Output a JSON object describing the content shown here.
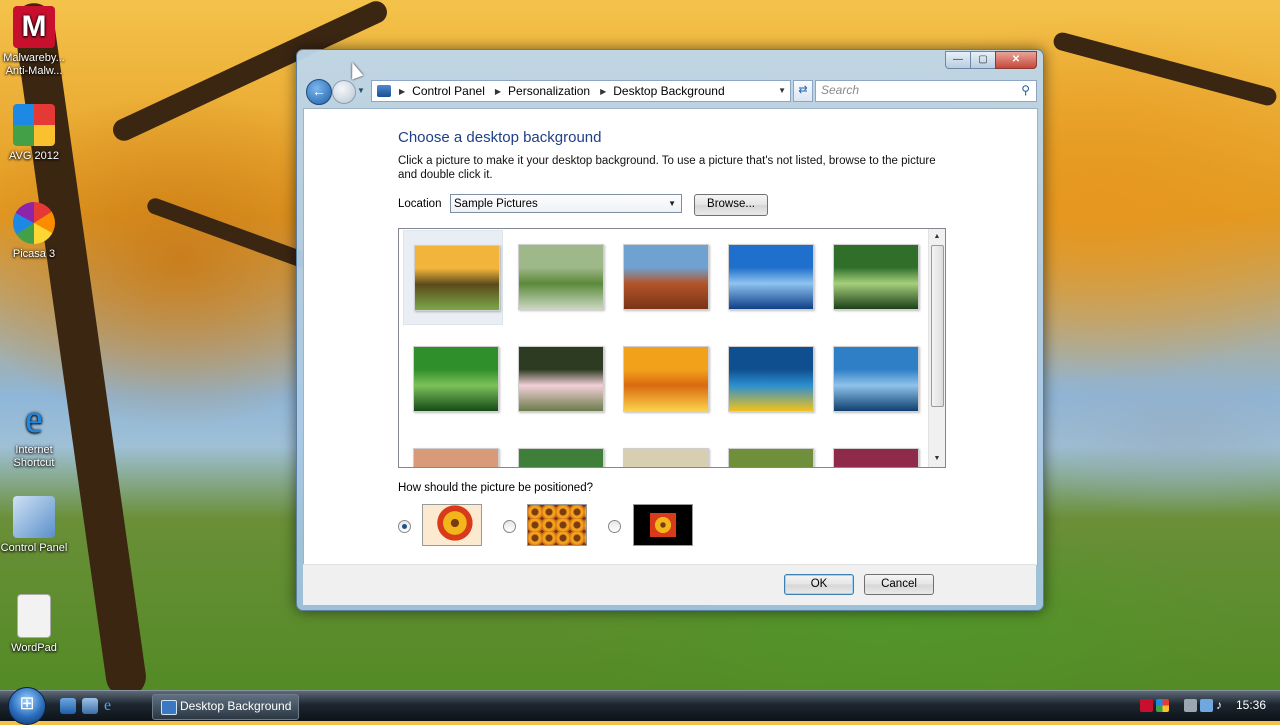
{
  "desktop": {
    "icons": [
      {
        "label": "Malwareby... Anti-Malw...",
        "icon": "malwarebytes-icon",
        "color": "#c8102e"
      },
      {
        "label": "AVG 2012",
        "icon": "avg-icon",
        "color": "#e64a19"
      },
      {
        "label": "Picasa 3",
        "icon": "picasa-icon",
        "color": "#4caf50"
      },
      {
        "label": "Internet Shortcut",
        "icon": "internet-explorer-icon",
        "color": "#1e88e5"
      },
      {
        "label": "Control Panel",
        "icon": "control-panel-icon",
        "color": "#5a8fc9"
      },
      {
        "label": "WordPad",
        "icon": "wordpad-icon",
        "color": "#f2f2f2"
      }
    ]
  },
  "window": {
    "title": "Desktop Background",
    "controls": {
      "minimize": "—",
      "maximize": "▢",
      "close": "✕"
    },
    "breadcrumb": [
      "Control Panel",
      "Personalization",
      "Desktop Background"
    ],
    "search_placeholder": "Search",
    "page_title": "Choose a desktop background",
    "intro": "Click a picture to make it your desktop background. To use a picture that's not listed, browse to the picture and double click it.",
    "location_label": "Location",
    "location_value": "Sample Pictures",
    "browse_label": "Browse...",
    "position_question": "How should the picture be positioned?",
    "position_options": [
      {
        "name": "fit-to-screen",
        "checked": true
      },
      {
        "name": "tile",
        "checked": false
      },
      {
        "name": "center",
        "checked": false
      }
    ],
    "ok_label": "OK",
    "cancel_label": "Cancel"
  },
  "gallery": {
    "selected_index": 0,
    "thumbnails": [
      {
        "subject": "autumn tree sunset",
        "colors": [
          "#f3b43b",
          "#5b4a1a",
          "#7aa84a"
        ]
      },
      {
        "subject": "green valley stream",
        "colors": [
          "#9fb88a",
          "#5b8a3a",
          "#c9d6c0"
        ]
      },
      {
        "subject": "desert buttes",
        "colors": [
          "#6fa2d1",
          "#b3552a",
          "#7a3416"
        ]
      },
      {
        "subject": "blue ice waters",
        "colors": [
          "#1f6fcc",
          "#8fc3f0",
          "#0f3f88"
        ]
      },
      {
        "subject": "forest path",
        "colors": [
          "#2f6f2a",
          "#a6cf7a",
          "#1c4019"
        ]
      },
      {
        "subject": "green leaves",
        "colors": [
          "#2f8f2a",
          "#7cc25a",
          "#164a16"
        ]
      },
      {
        "subject": "pink blossoms",
        "colors": [
          "#2d3b22",
          "#f2d0d8",
          "#6b7b4a"
        ]
      },
      {
        "subject": "orange flowers",
        "colors": [
          "#f2a21a",
          "#d96a10",
          "#fbd24a"
        ]
      },
      {
        "subject": "sea turtle",
        "colors": [
          "#0f4f8f",
          "#2c8fd0",
          "#f2c21a"
        ]
      },
      {
        "subject": "whale tail",
        "colors": [
          "#2f7fc7",
          "#8fc3ea",
          "#0f3f6f"
        ]
      },
      {
        "subject": "red rocks",
        "colors": [
          "#d99a7a",
          "#b8665a",
          "#7fa6d0"
        ]
      },
      {
        "subject": "green plants",
        "colors": [
          "#3f7f3a",
          "#8aa86a",
          "#2f4f2a"
        ]
      },
      {
        "subject": "bare tree",
        "colors": [
          "#d8cfb0",
          "#6a5a3a",
          "#a39a7a"
        ]
      },
      {
        "subject": "orange leaves",
        "colors": [
          "#6f8f3a",
          "#d87a2a",
          "#3f5f2a"
        ]
      },
      {
        "subject": "pink flower",
        "colors": [
          "#8f2a4a",
          "#f27aa6",
          "#4a1a2a"
        ]
      }
    ]
  },
  "taskbar": {
    "task_label": "Desktop Background",
    "clock": "15:36"
  }
}
